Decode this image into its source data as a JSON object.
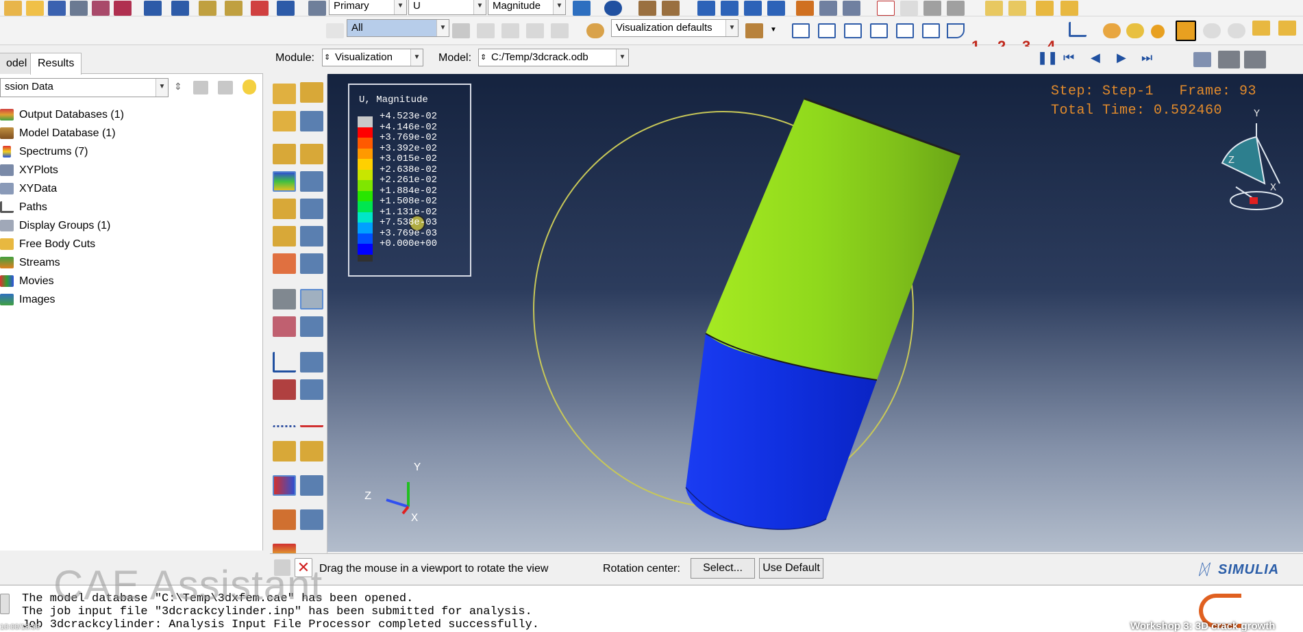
{
  "toolbar": {
    "primary_value": "Primary",
    "variable_value": "U",
    "invariant_value": "Magnitude",
    "selection_filter": "All",
    "visualization_defaults": "Visualization defaults",
    "view_numbers": [
      "1",
      "2",
      "3",
      "4"
    ]
  },
  "context": {
    "module_label": "Module:",
    "module_value": "Visualization",
    "model_label": "Model:",
    "model_value": "C:/Temp/3dcrack.odb"
  },
  "left_panel": {
    "tabs": [
      "odel",
      "Results"
    ],
    "session_combo": "ssion Data",
    "tree_items": [
      {
        "label": "Output Databases (1)",
        "icon": "output-databases-icon"
      },
      {
        "label": "Model Database (1)",
        "icon": "model-database-icon"
      },
      {
        "label": "Spectrums (7)",
        "icon": "spectrums-icon"
      },
      {
        "label": "XYPlots",
        "icon": "xyplots-icon"
      },
      {
        "label": "XYData",
        "icon": "xydata-icon"
      },
      {
        "label": "Paths",
        "icon": "paths-icon"
      },
      {
        "label": "Display Groups (1)",
        "icon": "display-groups-icon"
      },
      {
        "label": "Free Body Cuts",
        "icon": "free-body-cuts-icon"
      },
      {
        "label": "Streams",
        "icon": "streams-icon"
      },
      {
        "label": "Movies",
        "icon": "movies-icon"
      },
      {
        "label": "Images",
        "icon": "images-icon"
      }
    ]
  },
  "legend": {
    "title": "U, Magnitude",
    "entries": [
      {
        "label": "+4.523e-02",
        "color": "#c8c8c8"
      },
      {
        "label": "+4.146e-02",
        "color": "#ff0000"
      },
      {
        "label": "+3.769e-02",
        "color": "#ff5a00"
      },
      {
        "label": "+3.392e-02",
        "color": "#ff9900"
      },
      {
        "label": "+3.015e-02",
        "color": "#ffd000"
      },
      {
        "label": "+2.638e-02",
        "color": "#c8e600"
      },
      {
        "label": "+2.261e-02",
        "color": "#7fe600"
      },
      {
        "label": "+1.884e-02",
        "color": "#28e600"
      },
      {
        "label": "+1.508e-02",
        "color": "#00e650"
      },
      {
        "label": "+1.131e-02",
        "color": "#00e6c8"
      },
      {
        "label": "+7.538e-03",
        "color": "#00a0ff"
      },
      {
        "label": "+3.769e-03",
        "color": "#0050ff"
      },
      {
        "label": "+0.000e+00",
        "color": "#0000ff"
      }
    ],
    "end_color": "#303030"
  },
  "status": {
    "step_line": "Step: Step-1   Frame: 93",
    "time_line": "Total Time: 0.592460"
  },
  "triad": {
    "x": "X",
    "y": "Y",
    "z": "Z"
  },
  "prompt": {
    "message": "Drag the mouse in a viewport to rotate the view",
    "rotation_label": "Rotation center:",
    "select_button": "Select...",
    "default_button": "Use Default"
  },
  "brand": "SIMULIA",
  "messages": [
    "The model database \"C:\\Temp\\3dxfem.cae\" has been opened.",
    "The job input file \"3dcrackcylinder.inp\" has been submitted for analysis.",
    "Job 3dcrackcylinder: Analysis Input File Processor completed successfully."
  ],
  "watermark": "CAE Assistant",
  "video_title": "Workshop 3: 3D crack growth",
  "video_time": "10:00/18:36",
  "colors": {
    "upper_part": "#8fd81c",
    "lower_part": "#1030e0",
    "step_text": "#e38b2b",
    "number_buttons": "#c0281c"
  }
}
